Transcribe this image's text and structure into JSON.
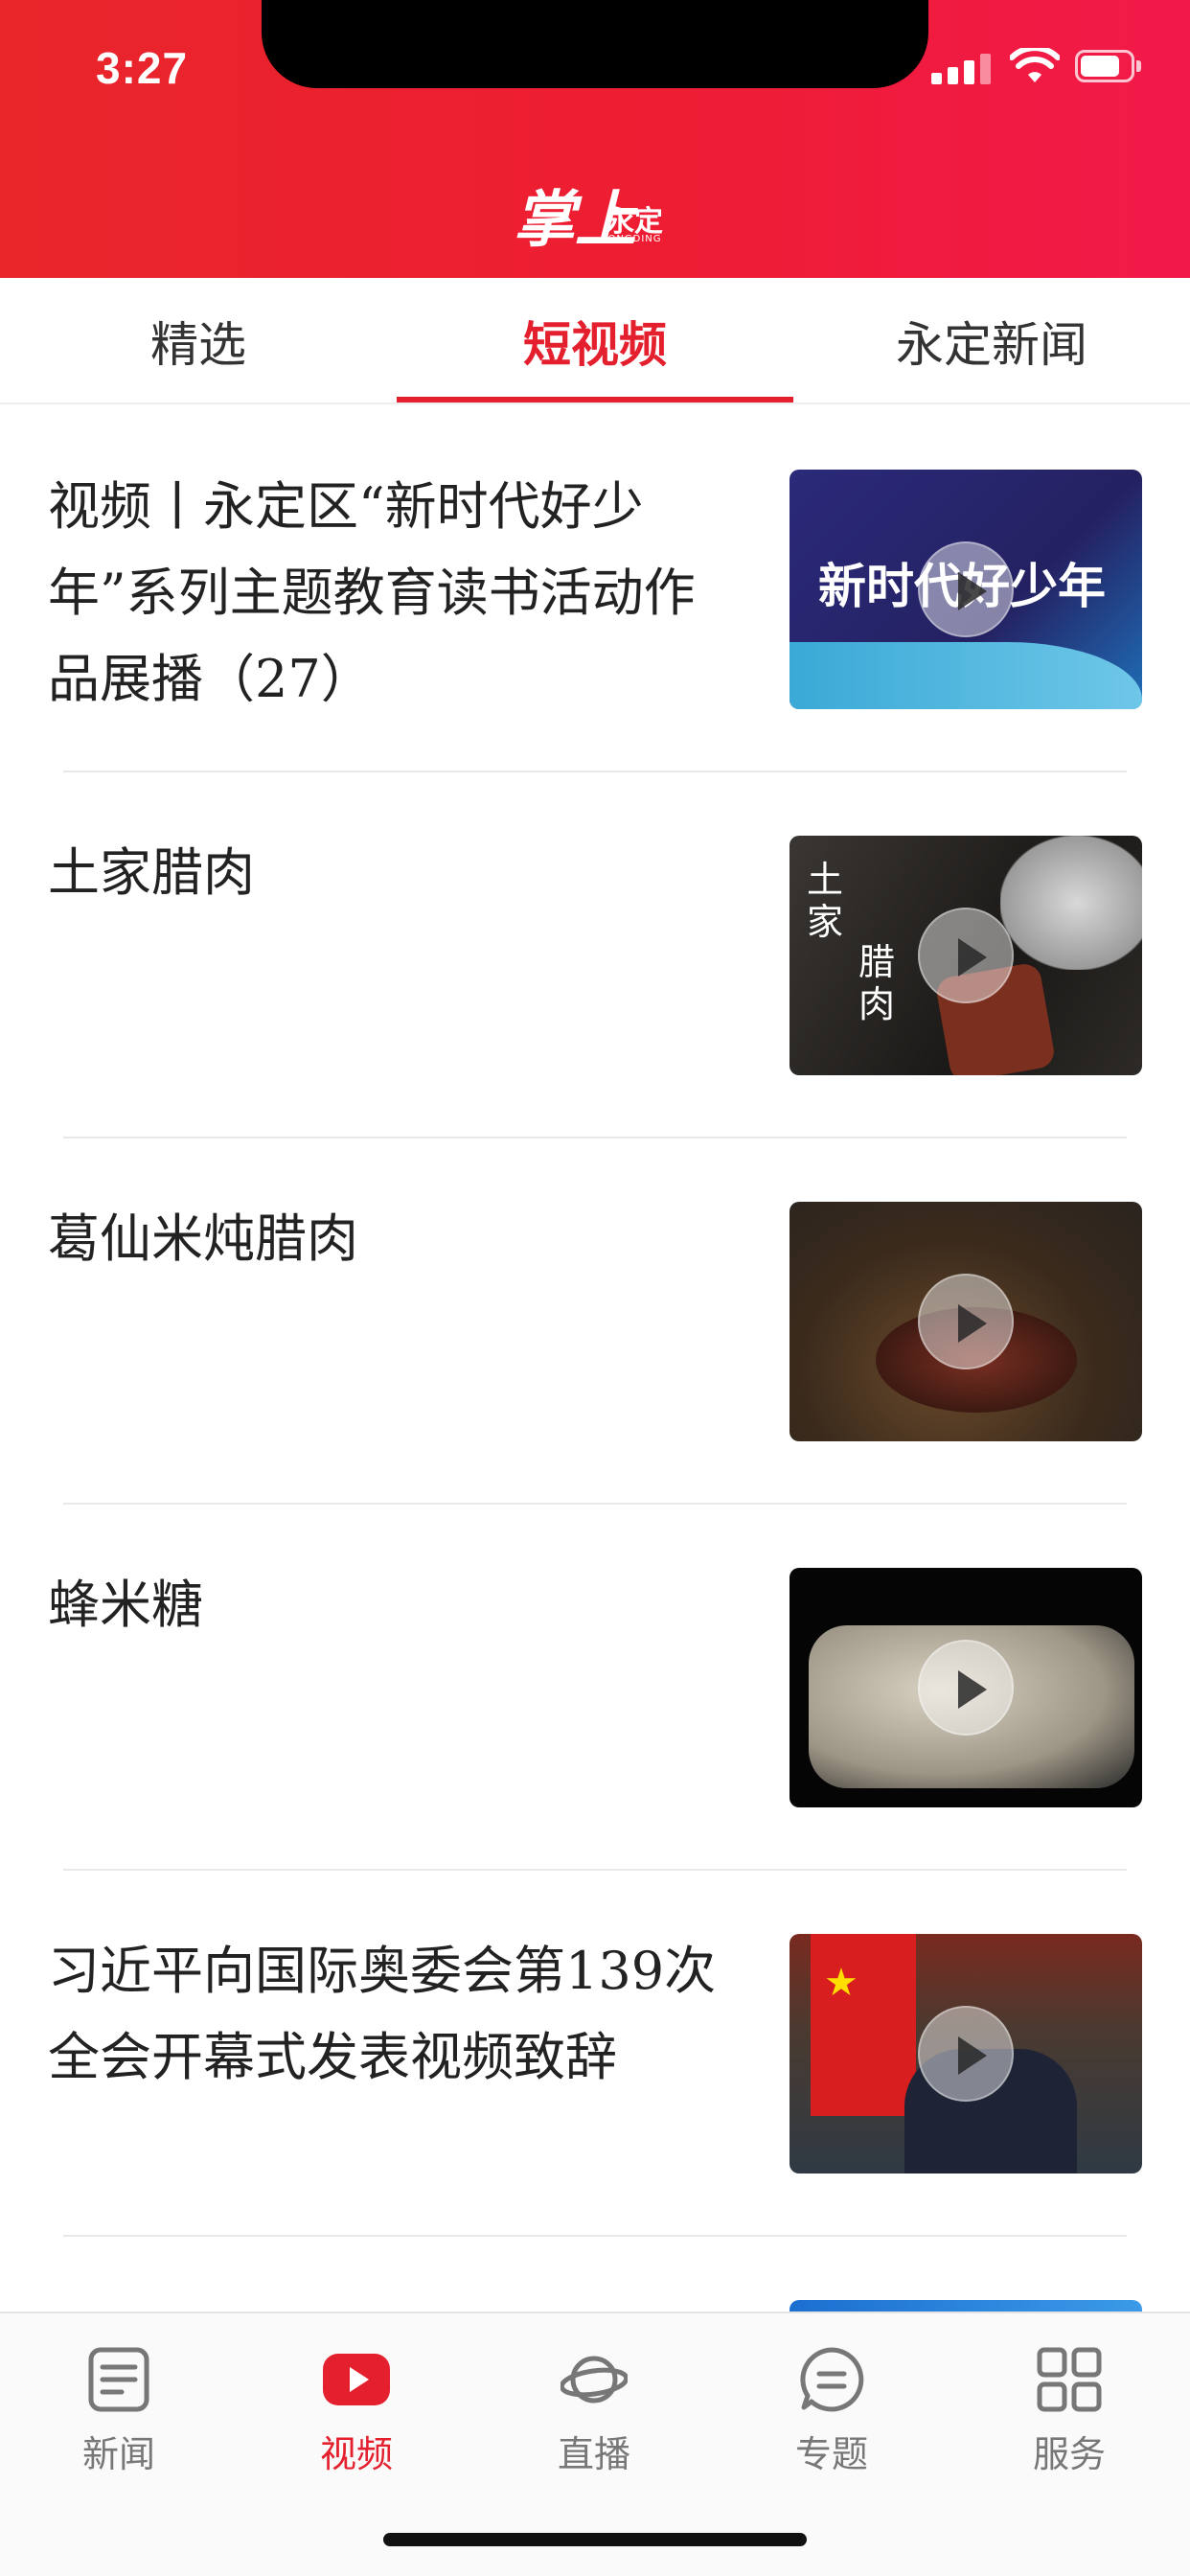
{
  "status_bar": {
    "time": "3:27"
  },
  "header": {
    "logo_main": "掌上",
    "logo_sub": "永定",
    "logo_en": "YONGDING"
  },
  "tabs": [
    {
      "label": "精选",
      "active": false
    },
    {
      "label": "短视频",
      "active": true
    },
    {
      "label": "永定新闻",
      "active": false
    }
  ],
  "feed": [
    {
      "title": "视频丨永定区“新时代好少年”系列主题教育读书活动作品展播（27）",
      "thumb_text": "新时代好少年"
    },
    {
      "title": "土家腊肉",
      "thumb_text_1": "土家",
      "thumb_text_2": "腊肉"
    },
    {
      "title": "葛仙米炖腊肉"
    },
    {
      "title": "蜂米糖"
    },
    {
      "title": "习近平向国际奥委会第139次全会开幕式发表视频致辞"
    }
  ],
  "bottom_nav": [
    {
      "label": "新闻",
      "icon": "news-icon",
      "active": false
    },
    {
      "label": "视频",
      "icon": "video-play-icon",
      "active": true
    },
    {
      "label": "直播",
      "icon": "live-planet-icon",
      "active": false
    },
    {
      "label": "专题",
      "icon": "topic-chat-icon",
      "active": false
    },
    {
      "label": "服务",
      "icon": "services-grid-icon",
      "active": false
    }
  ],
  "colors": {
    "brand_red": "#e5202e",
    "header_red": "#ee1d33",
    "nav_gray": "#777777"
  }
}
